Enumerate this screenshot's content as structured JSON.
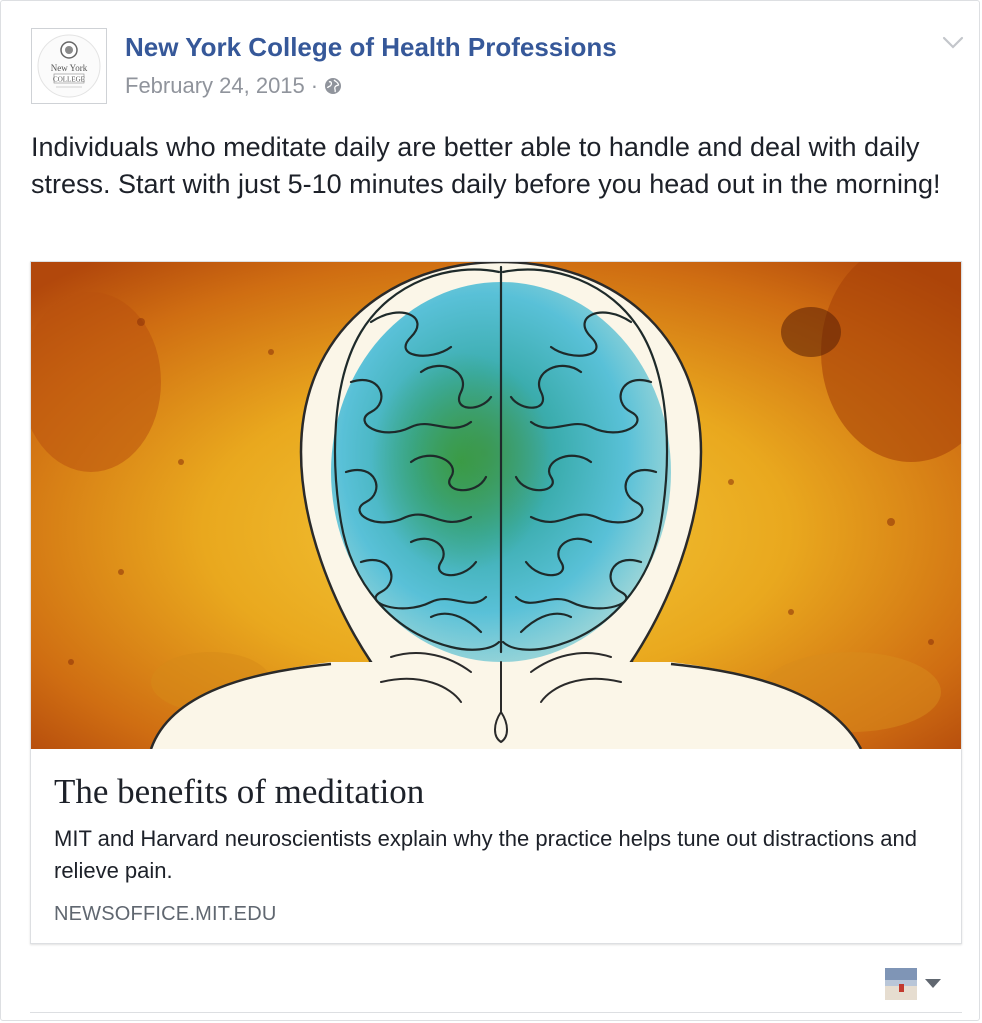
{
  "post": {
    "page_name": "New York College of Health Professions",
    "avatar_text": {
      "line1": "New York",
      "line2": "COLLEGE"
    },
    "date": "February 24, 2015",
    "separator": "·",
    "privacy_icon": "globe-icon",
    "options_icon": "chevron-down-icon",
    "text": "Individuals who meditate daily are better able to handle and deal with daily stress. Start with just 5-10 minutes daily before you head out in the morning!"
  },
  "link": {
    "title": "The benefits of meditation",
    "description": "MIT and Harvard neuroscientists explain why the practice helps tune out distractions and relieve pain.",
    "domain": "NEWSOFFICE.MIT.EDU"
  },
  "footer": {
    "audience_icon": "profile-thumbnail",
    "audience_caret_icon": "caret-down-icon"
  },
  "colors": {
    "link_blue": "#365899",
    "meta_gray": "#90949c",
    "text": "#1d2129",
    "border": "#dddfe2"
  }
}
